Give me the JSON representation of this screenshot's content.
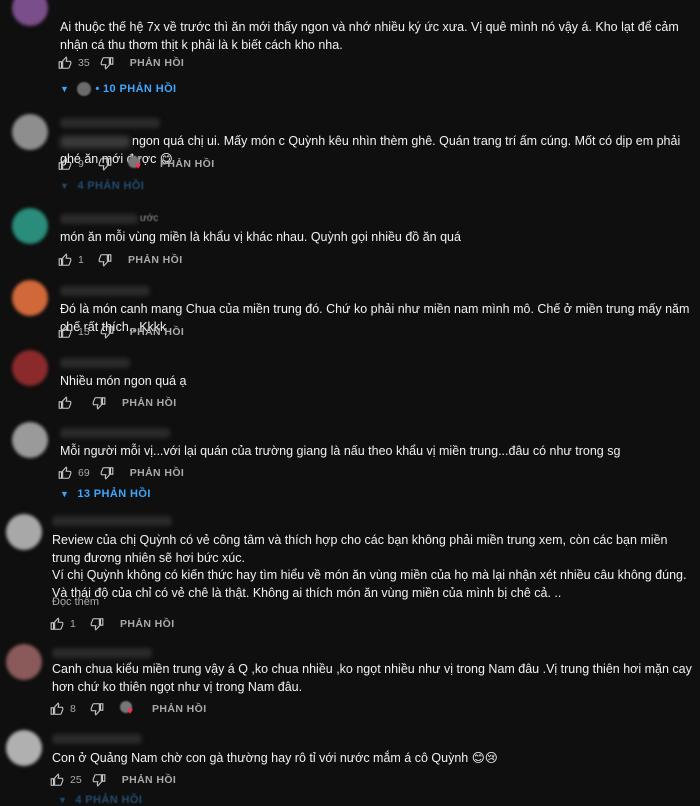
{
  "comments": [
    {
      "text": "Ai thuộc thế hệ 7x về trước thì ăn mới thấy ngon và nhớ nhiều ký ức xưa. Vị quê mình nó vậy á. Kho lạt để cảm nhận cá thu thơm thịt k phải là k biết cách kho nha.",
      "likes": "35",
      "reply_label": "PHẢN HỒI",
      "replies_label": "• 10 PHẢN HỒI",
      "avatar_color": "#7a4e8a"
    },
    {
      "text": "ngon quá chị ui. Mấy món c Quỳnh kêu nhìn thèm ghê. Quán trang trí ấm cúng. Mốt có dịp em phải ghé ăn mới được 😋",
      "likes": "9",
      "reply_label": "PHẢN HỒI",
      "replies_label": "4 PHẢN HỒI",
      "avatar_color": "#8e8e8e"
    },
    {
      "author_suffix": "ước",
      "text": "món ăn mỗi vùng miền là khẩu vị khác nhau. Quỳnh gọi nhiều đồ ăn quá",
      "likes": "1",
      "reply_label": "PHẢN HỒI",
      "avatar_color": "#2a8c7a"
    },
    {
      "text": "Đó là món canh mang Chua của miền trung đó. Chứ ko phải như miền nam mình mô. Chế ở miền trung mấy năm chế rất thích.. Kkkk",
      "likes": "15",
      "reply_label": "PHẢN HỒI",
      "avatar_color": "#d0683a"
    },
    {
      "text": "Nhiều món ngon quá ạ",
      "likes": "",
      "reply_label": "PHẢN HỒI",
      "avatar_color": "#8a2a2a"
    },
    {
      "text": "Mỗi người mỗi vị...với lại quán của trường giang là nấu theo khẩu vị miền trung...đâu có như trong sg",
      "likes": "69",
      "reply_label": "PHẢN HỒI",
      "replies_label": "13 PHẢN HỒI",
      "avatar_color": "#9a9a9a"
    },
    {
      "text": "Review của chị Quỳnh có vẻ công tâm và thích hợp cho các bạn không phải miền trung xem, còn các bạn miền trung đương nhiên sẽ hơi bức xúc.\nVí chị Quỳnh không có kiến thức hay tìm hiểu về món ăn vùng miền của họ mà lại nhận xét nhiều câu không đúng. Và thái độ của chỉ có vẻ chê là thật. Không ai thích món ăn vùng miền của mình bị chê cả. ..",
      "read_more": "Đọc thêm",
      "likes": "1",
      "reply_label": "PHẢN HỒI",
      "avatar_color": "#a8a8a8"
    },
    {
      "text": "Canh chua kiểu miền trung vậy á Q ,ko chua nhiều ,ko ngọt nhiều như vị trong Nam đâu .Vị trung thiên hơi mặn cay hơn chứ ko thiên ngọt như vị trong Nam đâu.",
      "likes": "8",
      "reply_label": "PHẢN HỒI",
      "avatar_color": "#8a5a5a"
    },
    {
      "text": "Con ở Quảng Nam chờ con gà thường hay rô tỉ với nước mắm á cô Quỳnh 😊😢",
      "likes": "25",
      "reply_label": "PHẢN HỒI",
      "replies_label": "4 PHẢN HỒI",
      "avatar_color": "#b0b0b0"
    }
  ],
  "colors": {
    "background": "#0f0f0f",
    "text": "#f1f1f1",
    "secondary": "#aaaaaa",
    "link": "#3ea6ff",
    "heart": "#ff2f4a"
  },
  "icons": [
    "like-icon",
    "dislike-icon",
    "caret-down-icon",
    "heart-icon"
  ]
}
